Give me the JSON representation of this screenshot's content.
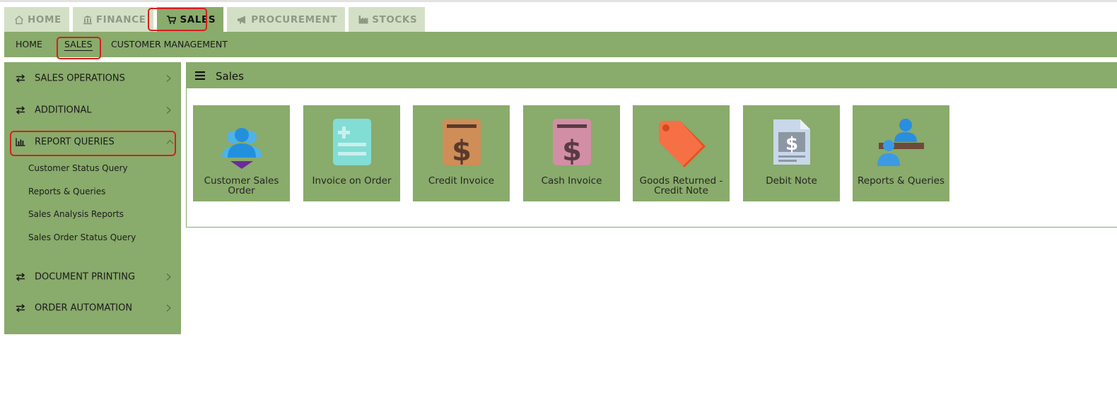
{
  "top_tabs": [
    {
      "label": "HOME",
      "icon": "home-icon"
    },
    {
      "label": "FINANCE",
      "icon": "bank-icon"
    },
    {
      "label": "SALES",
      "icon": "cart-icon",
      "active": true
    },
    {
      "label": "PROCUREMENT",
      "icon": "megaphone-icon"
    },
    {
      "label": "STOCKS",
      "icon": "factory-icon"
    }
  ],
  "subnav": [
    {
      "label": "HOME"
    },
    {
      "label": "SALES",
      "active": true
    },
    {
      "label": "CUSTOMER MANAGEMENT"
    }
  ],
  "sidebar": {
    "items": [
      {
        "label": "SALES OPERATIONS",
        "icon": "exchange-icon",
        "state": "collapsed"
      },
      {
        "label": "ADDITIONAL",
        "icon": "exchange-icon",
        "state": "collapsed"
      },
      {
        "label": "REPORT QUERIES",
        "icon": "bar-chart-icon",
        "state": "expanded"
      },
      {
        "label": "DOCUMENT PRINTING",
        "icon": "exchange-icon",
        "state": "collapsed"
      },
      {
        "label": "ORDER AUTOMATION",
        "icon": "exchange-icon",
        "state": "collapsed"
      }
    ],
    "report_queries_subitems": [
      "Customer Status Query",
      "Reports & Queries",
      "Sales Analysis Reports",
      "Sales Order Status Query"
    ]
  },
  "panel": {
    "title": "Sales",
    "tiles": [
      {
        "label": "Customer Sales Order",
        "icon": "customers-icon"
      },
      {
        "label": "Invoice on Order",
        "icon": "invoice-icon"
      },
      {
        "label": "Credit Invoice",
        "icon": "credit-invoice-icon"
      },
      {
        "label": "Cash Invoice",
        "icon": "cash-invoice-icon"
      },
      {
        "label": "Goods Returned - Credit Note",
        "icon": "price-tag-icon"
      },
      {
        "label": "Debit Note",
        "icon": "debit-note-icon"
      },
      {
        "label": "Reports & Queries",
        "icon": "reports-user-icon"
      }
    ]
  },
  "colors": {
    "nav_green": "#89ab6b",
    "tab_inactive": "#d3e0c6",
    "highlight_red": "#d42020"
  }
}
